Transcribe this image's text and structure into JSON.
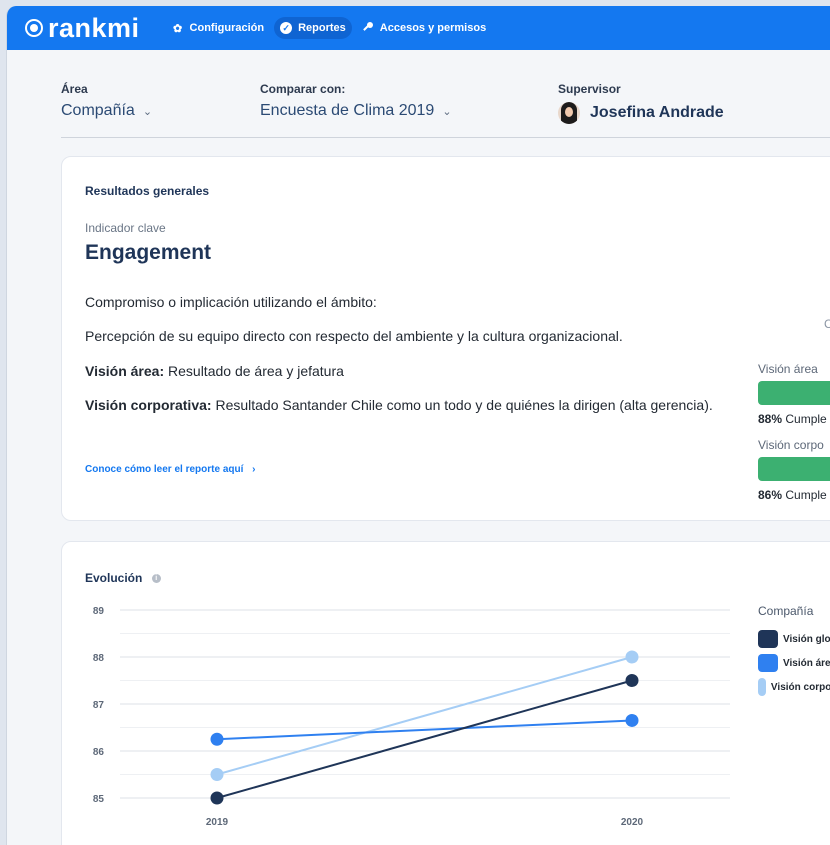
{
  "app": {
    "logo": "rankmi",
    "nav": [
      {
        "label": "Configuración",
        "icon": "gear-icon"
      },
      {
        "label": "Reportes",
        "icon": "check-circle-icon",
        "active": true
      },
      {
        "label": "Accesos y permisos",
        "icon": "key-icon"
      }
    ]
  },
  "filters": {
    "area": {
      "label": "Área",
      "value": "Compañía"
    },
    "compare": {
      "label": "Comparar con:",
      "value": "Encuesta de Clima 2019"
    },
    "supervisor": {
      "label": "Supervisor",
      "value": "Josefina Andrade"
    }
  },
  "results": {
    "section_title": "Resultados generales",
    "key_indicator": "Indicador clave",
    "title": "Engagement",
    "line1": "Compromiso o implicación utilizando el ámbito:",
    "line2": "Percepción de su equipo directo con respecto del ambiente y la cultura organizacional.",
    "vision_area_label": "Visión área:",
    "vision_area_text": " Resultado de área y jefatura",
    "vision_corp_label": "Visión corporativa:",
    "vision_corp_text": " Resultado Santander Chile como un todo y de quiénes la dirigen (alta gerencia).",
    "link": "Conoce cómo leer el reporte aquí",
    "side": {
      "header_fragment": "C",
      "area_label": "Visión área",
      "area_pct": "88%",
      "area_status": "Cumple",
      "corp_label": "Visión corpo",
      "corp_pct": "86%",
      "corp_status": "Cumple"
    },
    "colors": {
      "bar": "#3cb071"
    }
  },
  "evolution": {
    "title": "Evolución",
    "legend_title": "Compañía",
    "legend": [
      {
        "name": "Visión global",
        "color": "#1f3558"
      },
      {
        "name": "Visión área",
        "color": "#2f80f0"
      },
      {
        "name": "Visión corporativa",
        "color": "#a5cdf5"
      }
    ]
  },
  "chart_data": {
    "type": "line",
    "x": [
      "2019",
      "2020"
    ],
    "ylim": [
      85,
      89
    ],
    "yticks": [
      85,
      86,
      87,
      88,
      89
    ],
    "grid": true,
    "legend": "right",
    "series": [
      {
        "name": "Visión global",
        "color": "#1f3558",
        "values": [
          85.0,
          87.5
        ]
      },
      {
        "name": "Visión área",
        "color": "#2f80f0",
        "values": [
          86.25,
          86.65
        ]
      },
      {
        "name": "Visión corporativa",
        "color": "#a5cdf5",
        "values": [
          85.5,
          88.0
        ]
      }
    ]
  }
}
